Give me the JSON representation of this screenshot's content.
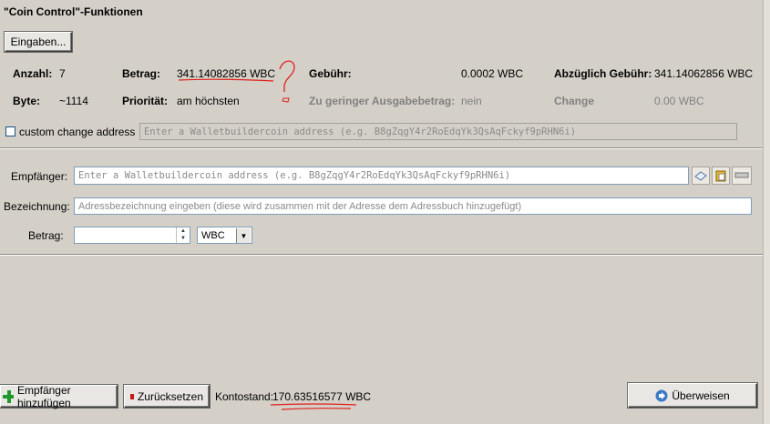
{
  "coin_control": {
    "title": "\"Coin Control\"-Funktionen",
    "inputs_button": "Eingaben...",
    "quantity_label": "Anzahl:",
    "quantity_value": "7",
    "amount_label": "Betrag:",
    "amount_value": "341.14082856 WBC",
    "fee_label": "Gebühr:",
    "fee_value": "0.0002 WBC",
    "after_fee_label": "Abzüglich Gebühr:",
    "after_fee_value": "341.14062856 WBC",
    "bytes_label": "Byte:",
    "bytes_value": "~1114",
    "priority_label": "Priorität:",
    "priority_value": "am höchsten",
    "lowoutput_label": "Zu geringer Ausgabebetrag:",
    "lowoutput_value": "nein",
    "change_label": "Change",
    "change_value": "0.00 WBC",
    "custom_change_label": "custom change address",
    "custom_change_placeholder": "Enter a Walletbuildercoin address (e.g. B8gZqgY4r2RoEdqYk3QsAqFckyf9pRHN6i)"
  },
  "send_entry": {
    "pay_to_label": "Empfänger:",
    "pay_to_placeholder": "Enter a Walletbuildercoin address (e.g. B8gZqgY4r2RoEdqYk3QsAqFckyf9pRHN6i)",
    "label_label": "Bezeichnung:",
    "label_placeholder": "Adressbezeichnung eingeben (diese wird zusammen mit der Adresse dem Adressbuch hinzugefügt)",
    "amount_label": "Betrag:",
    "amount_value": "",
    "unit_selected": "WBC",
    "icons": [
      "address-book-icon",
      "paste-icon",
      "delete-icon"
    ]
  },
  "bottom": {
    "add_recipient_button": "Empfänger hinzufügen",
    "clear_button": "Zurücksetzen",
    "balance_label": "Kontostand:",
    "balance_value": "170.63516577 WBC",
    "send_button": "Überweisen"
  },
  "colors": {
    "window_bg": "#d4d0c8",
    "annotation_red": "#e0201c",
    "field_border": "#7f9db9"
  }
}
